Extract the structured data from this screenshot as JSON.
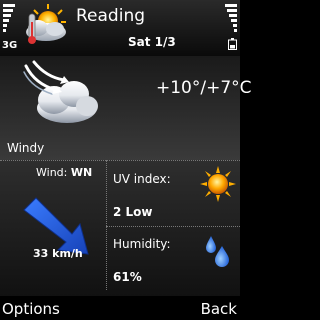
{
  "header": {
    "title": "Reading",
    "date": "Sat 1/3",
    "network": "3G"
  },
  "current": {
    "temperature": "+10°/+7°C",
    "condition": "Windy",
    "icon": "wind-cloud-icon"
  },
  "details": {
    "wind": {
      "label": "Wind:",
      "direction": "WN",
      "speed": "33 km/h",
      "icon": "wind-arrow-icon"
    },
    "uv": {
      "label": "UV index:",
      "value": "2 Low",
      "icon": "sun-icon"
    },
    "humidity": {
      "label": "Humidity:",
      "value": "61%",
      "icon": "water-drops-icon"
    }
  },
  "softkeys": {
    "left": "Options",
    "right": "Back"
  },
  "colors": {
    "background": "#000000",
    "arrow": "#1f5ce0",
    "sun": "#f5a000",
    "drops": "#2f78e8"
  }
}
